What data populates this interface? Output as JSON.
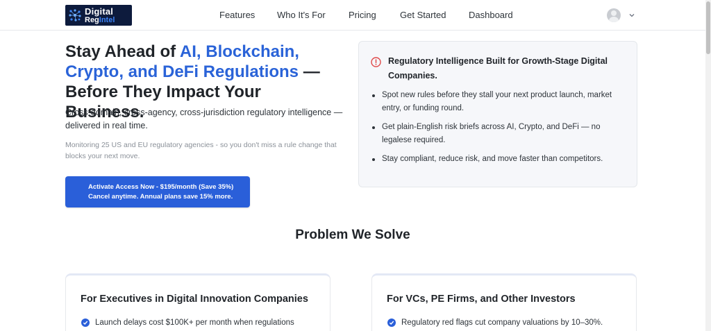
{
  "header": {
    "logo_line1": "Digital",
    "logo_line2_a": "Reg",
    "logo_line2_b": "Intel",
    "nav": [
      "Features",
      "Who It's For",
      "Pricing",
      "Get Started",
      "Dashboard"
    ]
  },
  "hero": {
    "title_a": "Stay Ahead of ",
    "title_highlight": "AI, Blockchain, Crypto, and DeFi Regulations",
    "title_b": " — Before They Impact Your Business.",
    "subtitle": "Cross-domain, cross-agency, cross-jurisdiction regulatory intelligence — delivered in real time.",
    "note": "Monitoring 25 US and EU regulatory agencies - so you don't miss a rule change that blocks your next move.",
    "cta_line1": "Activate Access Now - $195/month (Save 35%)",
    "cta_line2": "Cancel anytime. Annual plans save 15% more."
  },
  "info_card": {
    "title": "Regulatory Intelligence Built for Growth-Stage Digital Companies.",
    "bullets": [
      "Spot new rules before they stall your next product launch, market entry, or funding round.",
      "Get plain-English risk briefs across AI, Crypto, and DeFi — no legalese required.",
      "Stay compliant, reduce risk, and move faster than competitors."
    ]
  },
  "problem": {
    "heading": "Problem We Solve",
    "cards": [
      {
        "title": "For Executives in Digital Innovation Companies",
        "first_item": "Launch delays cost $100K+ per month when regulations"
      },
      {
        "title": "For VCs, PE Firms, and Other Investors",
        "first_item": "Regulatory red flags cut company valuations by 10–30%."
      }
    ]
  },
  "colors": {
    "accent": "#2a5fd9",
    "highlight": "#2a63d8",
    "alert": "#e04a4a",
    "logo_bg": "#0d1b3d"
  },
  "icons": [
    "logo-mark-icon",
    "user-avatar-icon",
    "chevron-down-icon",
    "alert-circle-icon",
    "check-circle-icon"
  ]
}
